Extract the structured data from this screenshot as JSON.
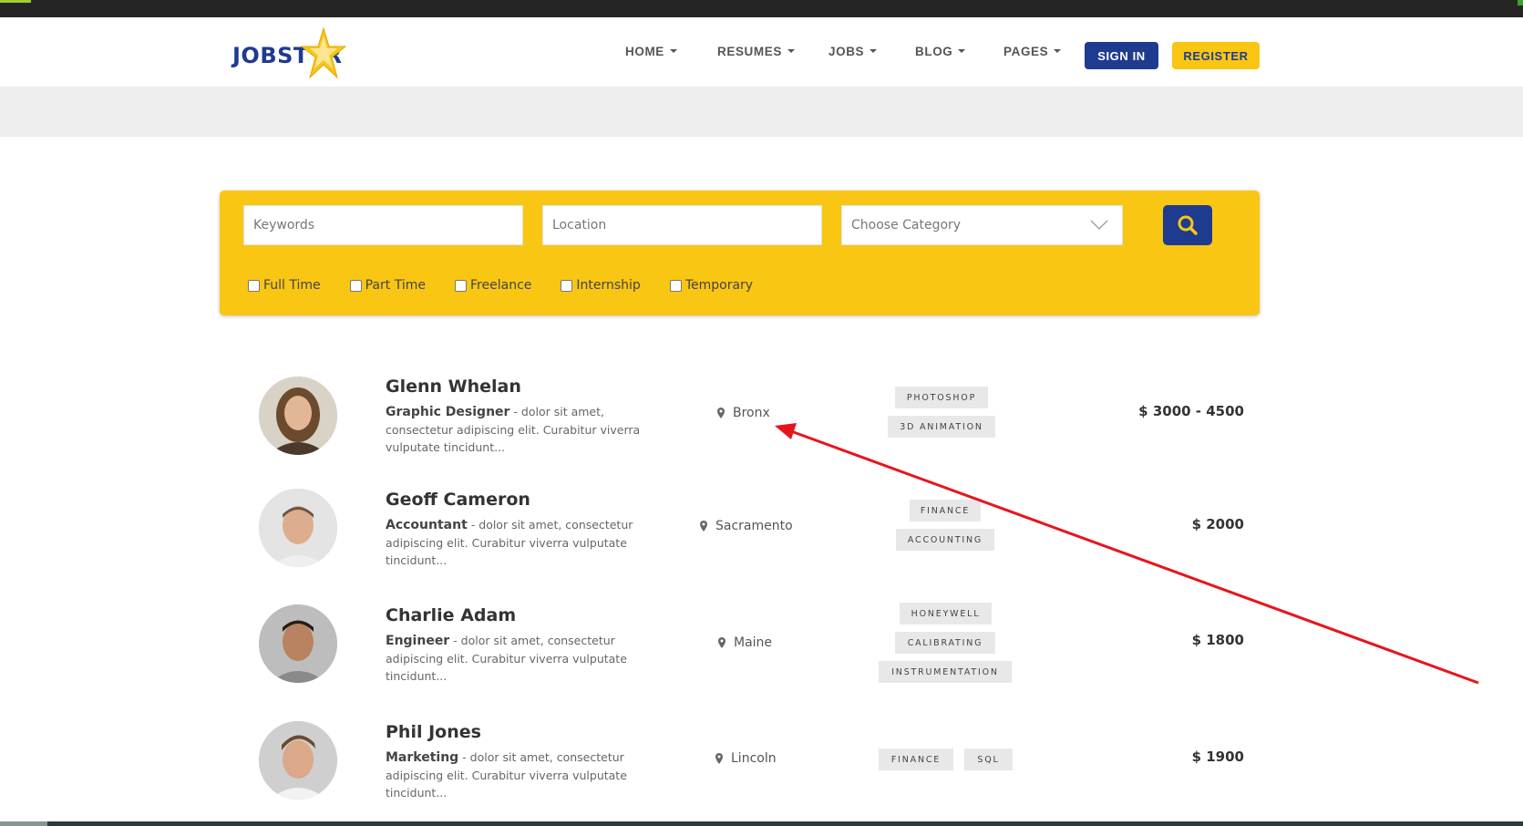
{
  "brand": {
    "logo_text": "JOBST  R"
  },
  "nav": {
    "items": [
      {
        "label": "HOME"
      },
      {
        "label": "RESUMES"
      },
      {
        "label": "JOBS"
      },
      {
        "label": "BLOG"
      },
      {
        "label": "PAGES"
      }
    ],
    "sign_in": "SIGN IN",
    "register": "REGISTER"
  },
  "search": {
    "keywords_placeholder": "Keywords",
    "location_placeholder": "Location",
    "category_selected": "Choose Category",
    "job_types": [
      "Full Time",
      "Part Time",
      "Freelance",
      "Internship",
      "Temporary"
    ]
  },
  "candidates": [
    {
      "name": "Glenn Whelan",
      "role": "Graphic Designer",
      "desc": " - dolor sit amet, consectetur adipiscing elit. Curabitur viverra vulputate tincidunt...",
      "location": "Bronx",
      "tags": [
        "PHOTOSHOP",
        "3D ANIMATION"
      ],
      "salary": "$ 3000 - 4500"
    },
    {
      "name": "Geoff Cameron",
      "role": "Accountant",
      "desc": " - dolor sit amet, consectetur adipiscing elit. Curabitur viverra vulputate tincidunt...",
      "location": "Sacramento",
      "tags": [
        "FINANCE",
        "ACCOUNTING"
      ],
      "salary": "$ 2000"
    },
    {
      "name": "Charlie Adam",
      "role": "Engineer",
      "desc": " - dolor sit amet, consectetur adipiscing elit. Curabitur viverra vulputate tincidunt...",
      "location": "Maine",
      "tags": [
        "HONEYWELL",
        "CALIBRATING",
        "INSTRUMENTATION"
      ],
      "salary": "$ 1800"
    },
    {
      "name": "Phil Jones",
      "role": "Marketing",
      "desc": " - dolor sit amet, consectetur adipiscing elit. Curabitur viverra vulputate tincidunt...",
      "location": "Lincoln",
      "tags": [
        "FINANCE",
        "SQL"
      ],
      "salary": "$ 1900"
    }
  ],
  "colors": {
    "brand_blue": "#1f3b8f",
    "brand_yellow": "#f9c614",
    "annotation_red": "#e8141c"
  }
}
